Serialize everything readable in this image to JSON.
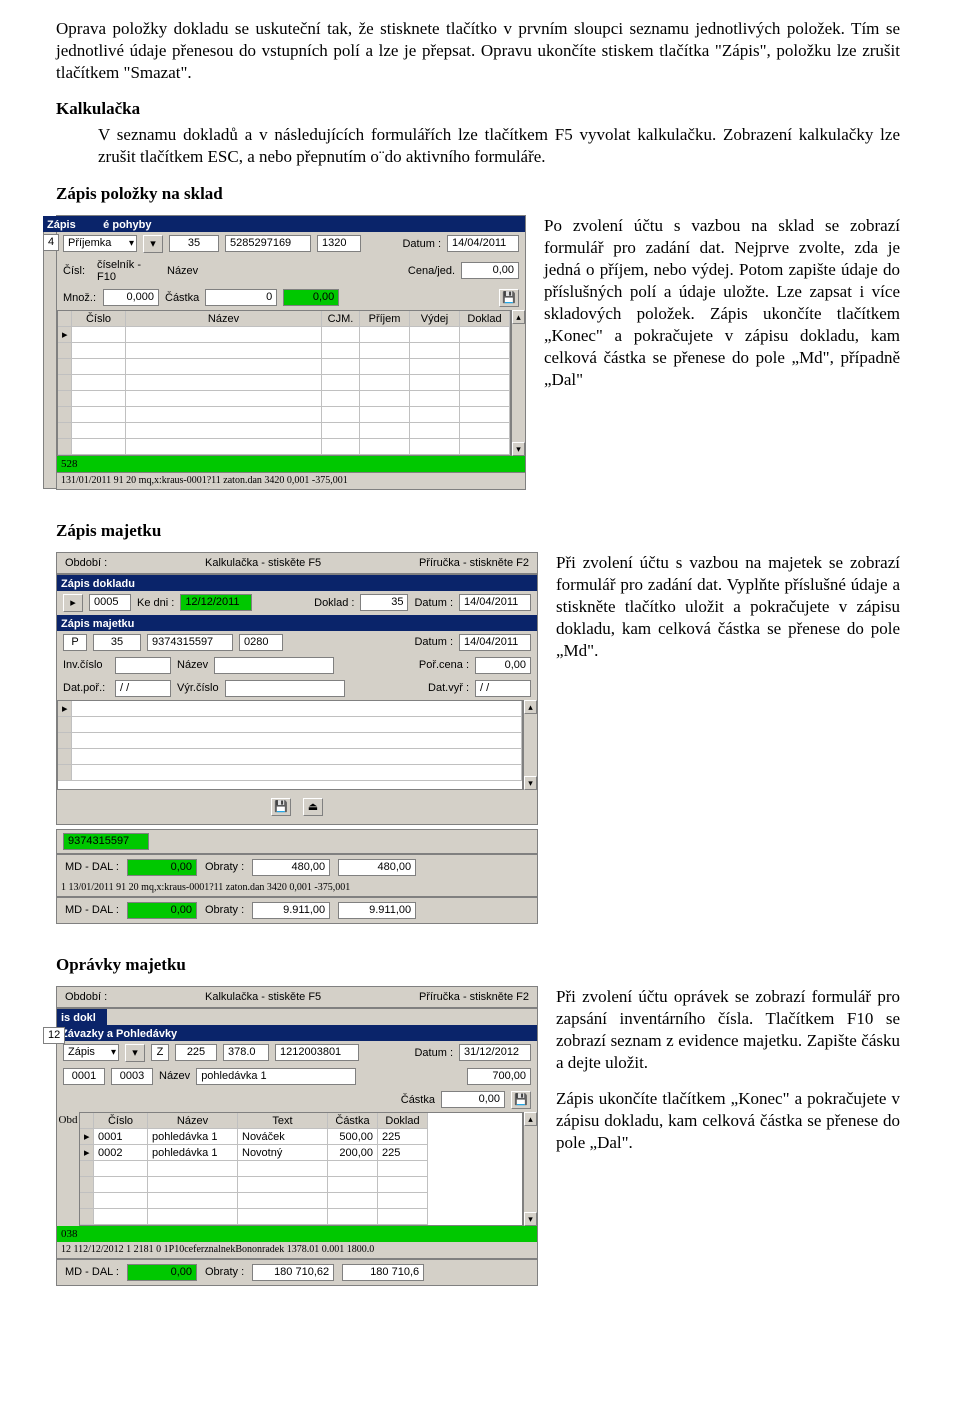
{
  "intro_para": "Oprava položky dokladu se uskuteční tak, že stisknete tlačítko v prvním sloupci seznamu jednotlivých položek. Tím se jednotlivé údaje přenesou do vstupních polí a lze je přepsat. Opravu ukončíte stiskem tlačítka \"Zápis\", položku lze zrušit tlačítkem \"Smazat\".",
  "kalkulacka_heading": "Kalkulačka",
  "kalkulacka_para": "V seznamu dokladů a v následujících formulářích lze tlačítkem F5 vyvolat kalkulačku. Zobrazení kalkulačky lze zrušit tlačítkem ESC, a nebo přepnutím o¨do aktivního formuláře.",
  "sklad_heading": "Zápis položky na sklad",
  "sklad_para": "Po zvolení účtu s vazbou na sklad se zobrazí formulář pro zadání dat. Nejprve zvolte, zda je jedná o příjem, nebo výdej. Potom zapište údaje do příslušných polí a údaje uložte. Lze zapsat i více skladových položek. Zápis ukončíte tlačítkem „Konec\" a pokračujete v zápisu dokladu, kam celková částka se přenese do pole „Md\", případně „Dal\"",
  "maj_heading": "Zápis majetku",
  "maj_para": "Při zvolení účtu s vazbou na majetek se zobrazí formulář pro zadání dat. Vyplňte příslušné údaje a stiskněte tlačítko uložit a pokračujete v zápisu dokladu, kam celková částka se přenese do pole „Md\".",
  "opr_heading": "Oprávky majetku",
  "opr_para": "Při zvolení účtu oprávek se zobrazí formulář pro zapsání inventárního čísla. Tlačítkem F10 se zobrazí seznam z evidence majetku. Zapište čásku a dejte uložit.",
  "opr_para2": "Zápis ukončíte tlačítkem „Konec\" a pokračujete v zápisu dokladu, kam celková částka se přenese do pole „Dal\".",
  "shot1": {
    "title_back": "Zápis",
    "title": "Skladové pohyby",
    "num_left": "4",
    "type": "Příjemka",
    "f1": "35",
    "f2": "5285297169",
    "f3": "1320",
    "datum_lbl": "Datum :",
    "datum": "14/04/2011",
    "cislo_lbl": "Čísl:",
    "ciselnik": "číselník - F10",
    "nazev_lbl": "Název",
    "cena_lbl": "Cena/jed.",
    "cena": "0,00",
    "mnoz_lbl": "Množ.:",
    "mnoz": "0,000",
    "castka_lbl": "Částka",
    "castka_a": "0",
    "castka_b": "0,00",
    "cols": [
      "Číslo",
      "Název",
      "CJM.",
      "Příjem",
      "Výdej",
      "Doklad"
    ],
    "foot": "528",
    "foot2": "131/01/2011    91 20  mq,x:kraus-0001?11 zaton.dan   3420      0,001      -375,001"
  },
  "shot2": {
    "topbar_lbls": {
      "obdobi": "Období :",
      "kalk": "Kalkulačka - stiskěte F5",
      "pri": "Příručka - stiskněte F2"
    },
    "bar1": "Zápis dokladu",
    "row1": {
      "n": "0005",
      "kedni_lbl": "Ke dni :",
      "kedni": "12/12/2011",
      "doklad_lbl": "Doklad :",
      "doklad": "35",
      "datum_lbl": "Datum :",
      "datum": "14/04/2011"
    },
    "bar2": "Zápis majetku",
    "row2": {
      "p": "P",
      "a": "35",
      "b": "9374315597",
      "c": "0280",
      "datum_lbl": "Datum :",
      "datum": "14/04/2011"
    },
    "row3": {
      "inv_lbl": "Inv.číslo",
      "naz_lbl": "Název",
      "por_lbl": "Poř.cena :",
      "por": "0,00"
    },
    "row4": {
      "dat_lbl": "Dat.poř.:",
      "dat": "/ /",
      "vyr_lbl": "Výr.číslo",
      "vyr2_lbl": "Dat.vyř :",
      "vyr2": "/ /"
    },
    "green_val": "9374315597",
    "tot1": {
      "md_lbl": "MD - DAL :",
      "md": "0,00",
      "ob_lbl": "Obraty :",
      "a": "480,00",
      "b": "480,00"
    },
    "stubline": "1  13/01/2011    91 20  mq,x:kraus-0001?11 zaton.dan   3420      0,001      -375,001",
    "tot2": {
      "md_lbl": "MD - DAL :",
      "md": "0,00",
      "ob_lbl": "Obraty :",
      "a": "9.911,00",
      "b": "9.911,00"
    }
  },
  "shot3": {
    "topbar_lbls": {
      "obdobi": "Období :",
      "kalk": "Kalkulačka - stiskěte F5",
      "pri": "Příručka - stiskněte F2"
    },
    "bar1": "is dokl",
    "bar2": "Závazky a Pohledávky",
    "num_left": "12",
    "row1": {
      "zapis": "Zápis",
      "z": "Z",
      "a": "225",
      "b": "378.0",
      "c": "1212003801",
      "datum_lbl": "Datum :",
      "datum": "31/12/2012"
    },
    "row2": {
      "a": "0001",
      "b": "0003",
      "naz_lbl": "Název",
      "naz": "pohledávka 1",
      "v": "700,00"
    },
    "row3": {
      "castka_lbl": "Částka",
      "castka": "0,00"
    },
    "obd": "Obd",
    "cols": [
      "Číslo",
      "Název",
      "Text",
      "Částka",
      "Doklad"
    ],
    "rows": [
      {
        "cis": "0001",
        "naz": "pohledávka 1",
        "txt": "Nováček",
        "cast": "500,00",
        "dok": "225"
      },
      {
        "cis": "0002",
        "naz": "pohledávka 1",
        "txt": "Novotný",
        "cast": "200,00",
        "dok": "225"
      }
    ],
    "footline": "12 112/12/2012 1    2181  0  1P10ceferznalnekBononradek  1378.01    0.001      1800.0",
    "tot": {
      "md_lbl": "MD - DAL :",
      "md": "0,00",
      "ob_lbl": "Obraty :",
      "a": "180 710,62",
      "b": "180 710,6"
    },
    "green": "038"
  }
}
